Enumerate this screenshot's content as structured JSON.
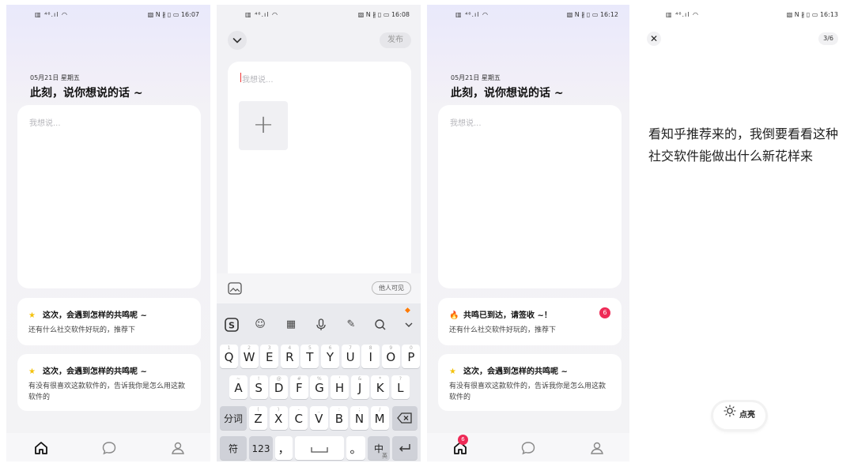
{
  "status_bar": {
    "left": "▥ ⁴⁶.ıl ◠",
    "right_icons": "▧ N ∦ ▯ ▭",
    "times": [
      "16:07",
      "16:08",
      "16:12",
      "16:13"
    ]
  },
  "compose": {
    "date": "05月21日 星期五",
    "prompt": "此刻，说你想说的话 ~",
    "placeholder": "我想说..."
  },
  "screen1": {
    "cards": [
      {
        "title": "这次，会遇到怎样的共鸣呢 ~",
        "text": "还有什么社交软件好玩的，推荐下"
      },
      {
        "title": "这次，会遇到怎样的共鸣呢 ~",
        "text": "有没有很喜欢这款软件的，告诉我你是怎么用这款软件的"
      }
    ]
  },
  "screen2": {
    "publish_label": "发布",
    "placeholder": "我想说...",
    "visibility": "他人可见",
    "keyboard": {
      "row1": [
        "Q",
        "W",
        "E",
        "R",
        "T",
        "Y",
        "U",
        "I",
        "O",
        "P"
      ],
      "row1_sup": [
        "1",
        "2",
        "3",
        "4",
        "5",
        "6",
        "7",
        "8",
        "9",
        "0"
      ],
      "row2": [
        "A",
        "S",
        "D",
        "F",
        "G",
        "H",
        "J",
        "K",
        "L"
      ],
      "row2_sup": [
        "~",
        "!",
        "@",
        "#",
        "%",
        "'",
        "&",
        "*",
        "?"
      ],
      "row3": [
        "Z",
        "X",
        "C",
        "V",
        "B",
        "N",
        "M"
      ],
      "row3_sup": [
        "(",
        ")",
        "-",
        "_",
        ":",
        ";",
        "/"
      ],
      "fenci": "分词",
      "fu": "符",
      "num": "123",
      "comma": "，",
      "period": "。",
      "zh": "中",
      "zh_sub": "英"
    }
  },
  "screen3": {
    "cards": [
      {
        "title": "共鸣已到达，请签收 ~！",
        "text": "还有什么社交软件好玩的，推荐下",
        "badge": "6"
      },
      {
        "title": "这次，会遇到怎样的共鸣呢 ~",
        "text": "有没有很喜欢这款软件的，告诉我你是怎么用这款软件的"
      }
    ],
    "home_badge": "6"
  },
  "screen4": {
    "pager": "3/6",
    "text": "看知乎推荐来的，我倒要看看这种社交软件能做出什么新花样来",
    "light_label": "点亮"
  }
}
